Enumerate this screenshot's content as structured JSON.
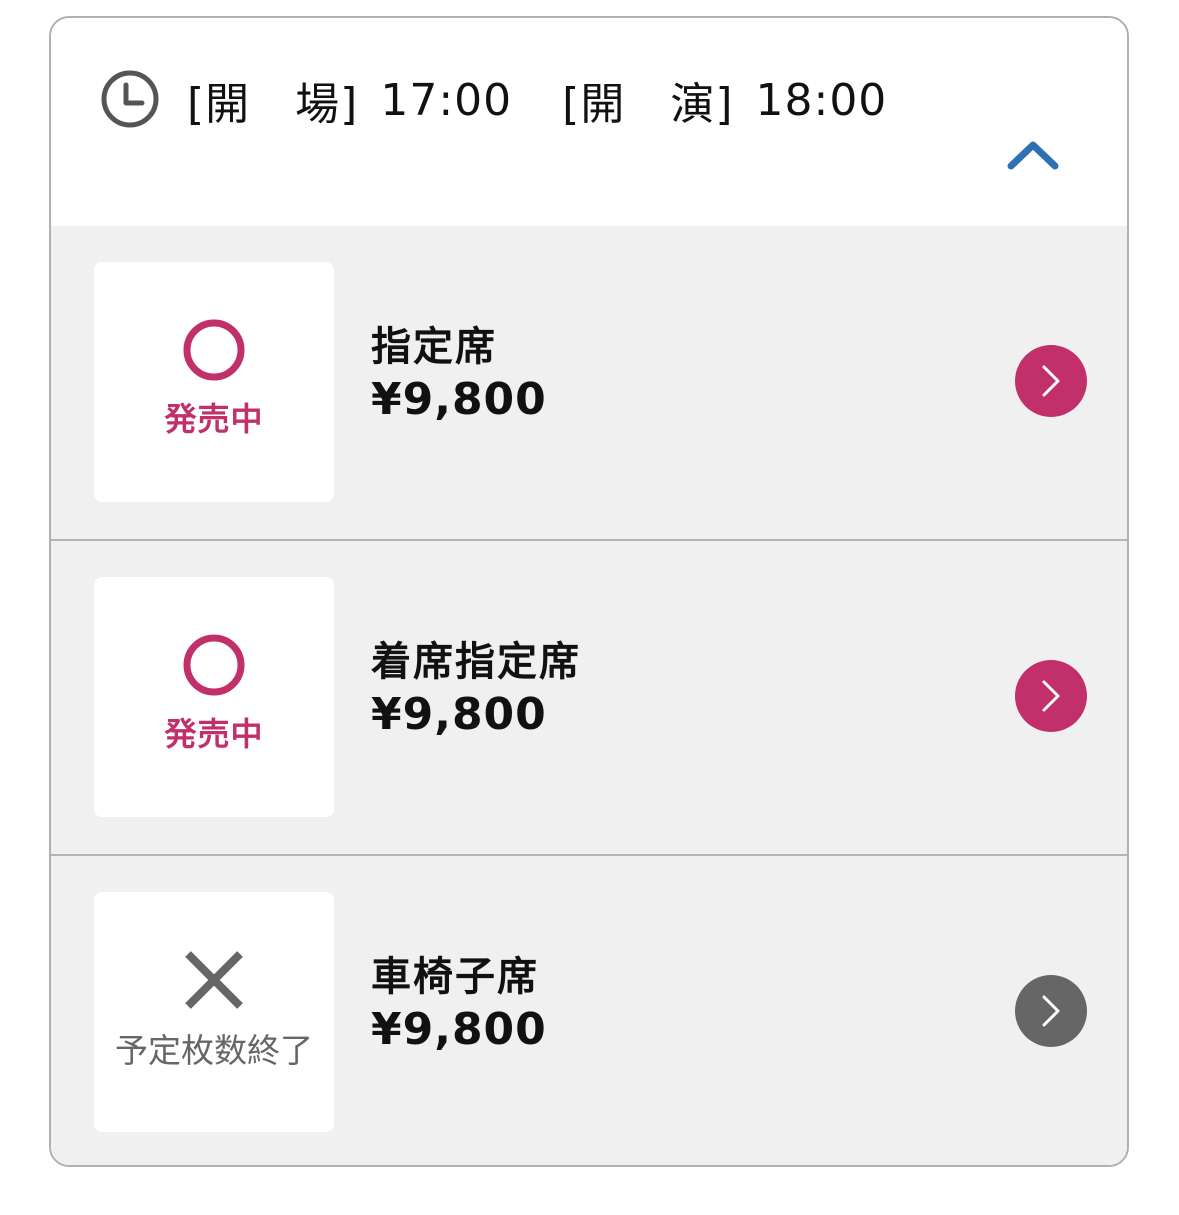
{
  "header": {
    "open_label": "[開　場]",
    "open_time": "17:00",
    "start_label": "[開　演]",
    "start_time": "18:00",
    "clock_icon": "clock-icon",
    "collapse_icon": "chevron-up-icon"
  },
  "colors": {
    "accent": "#c2306b",
    "chevron_blue": "#2f6fb3",
    "disabled": "#666666",
    "row_bg": "#f0f0f0"
  },
  "tickets": [
    {
      "status_icon": "circle-icon",
      "status": "発売中",
      "name": "指定席",
      "price": "¥9,800",
      "available": true
    },
    {
      "status_icon": "circle-icon",
      "status": "発売中",
      "name": "着席指定席",
      "price": "¥9,800",
      "available": true
    },
    {
      "status_icon": "cross-icon",
      "status": "予定枚数終了",
      "name": "車椅子席",
      "price": "¥9,800",
      "available": false
    }
  ]
}
